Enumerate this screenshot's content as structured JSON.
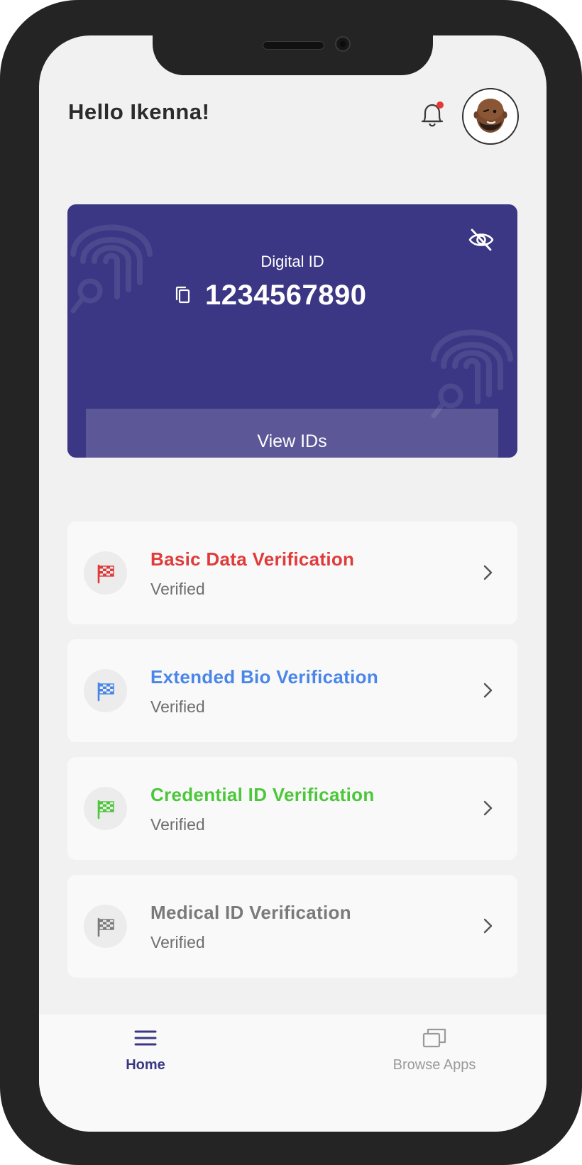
{
  "header": {
    "greeting": "Hello Ikenna!",
    "notification_dot_color": "#e53935",
    "avatar_icon": "user-avatar"
  },
  "digital_id": {
    "label": "Digital ID",
    "number": "1234567890",
    "action_label": "View IDs",
    "card_color": "#3b3784",
    "visibility_icon": "eye-off-icon",
    "copy_icon": "copy-icon"
  },
  "verifications": [
    {
      "title": "Basic Data Verification",
      "status": "Verified",
      "color": "#e03b3b"
    },
    {
      "title": "Extended Bio Verification",
      "status": "Verified",
      "color": "#4a86e8"
    },
    {
      "title": "Credential ID Verification",
      "status": "Verified",
      "color": "#4cc73a"
    },
    {
      "title": "Medical ID Verification",
      "status": "Verified",
      "color": "#7a7a7a"
    }
  ],
  "bottom_nav": {
    "items": [
      {
        "label": "Home",
        "icon": "menu-icon",
        "active": true,
        "color": "#3b3784"
      },
      {
        "label": "Browse Apps",
        "icon": "windows-icon",
        "active": false,
        "color": "#9a9a9a"
      }
    ]
  }
}
